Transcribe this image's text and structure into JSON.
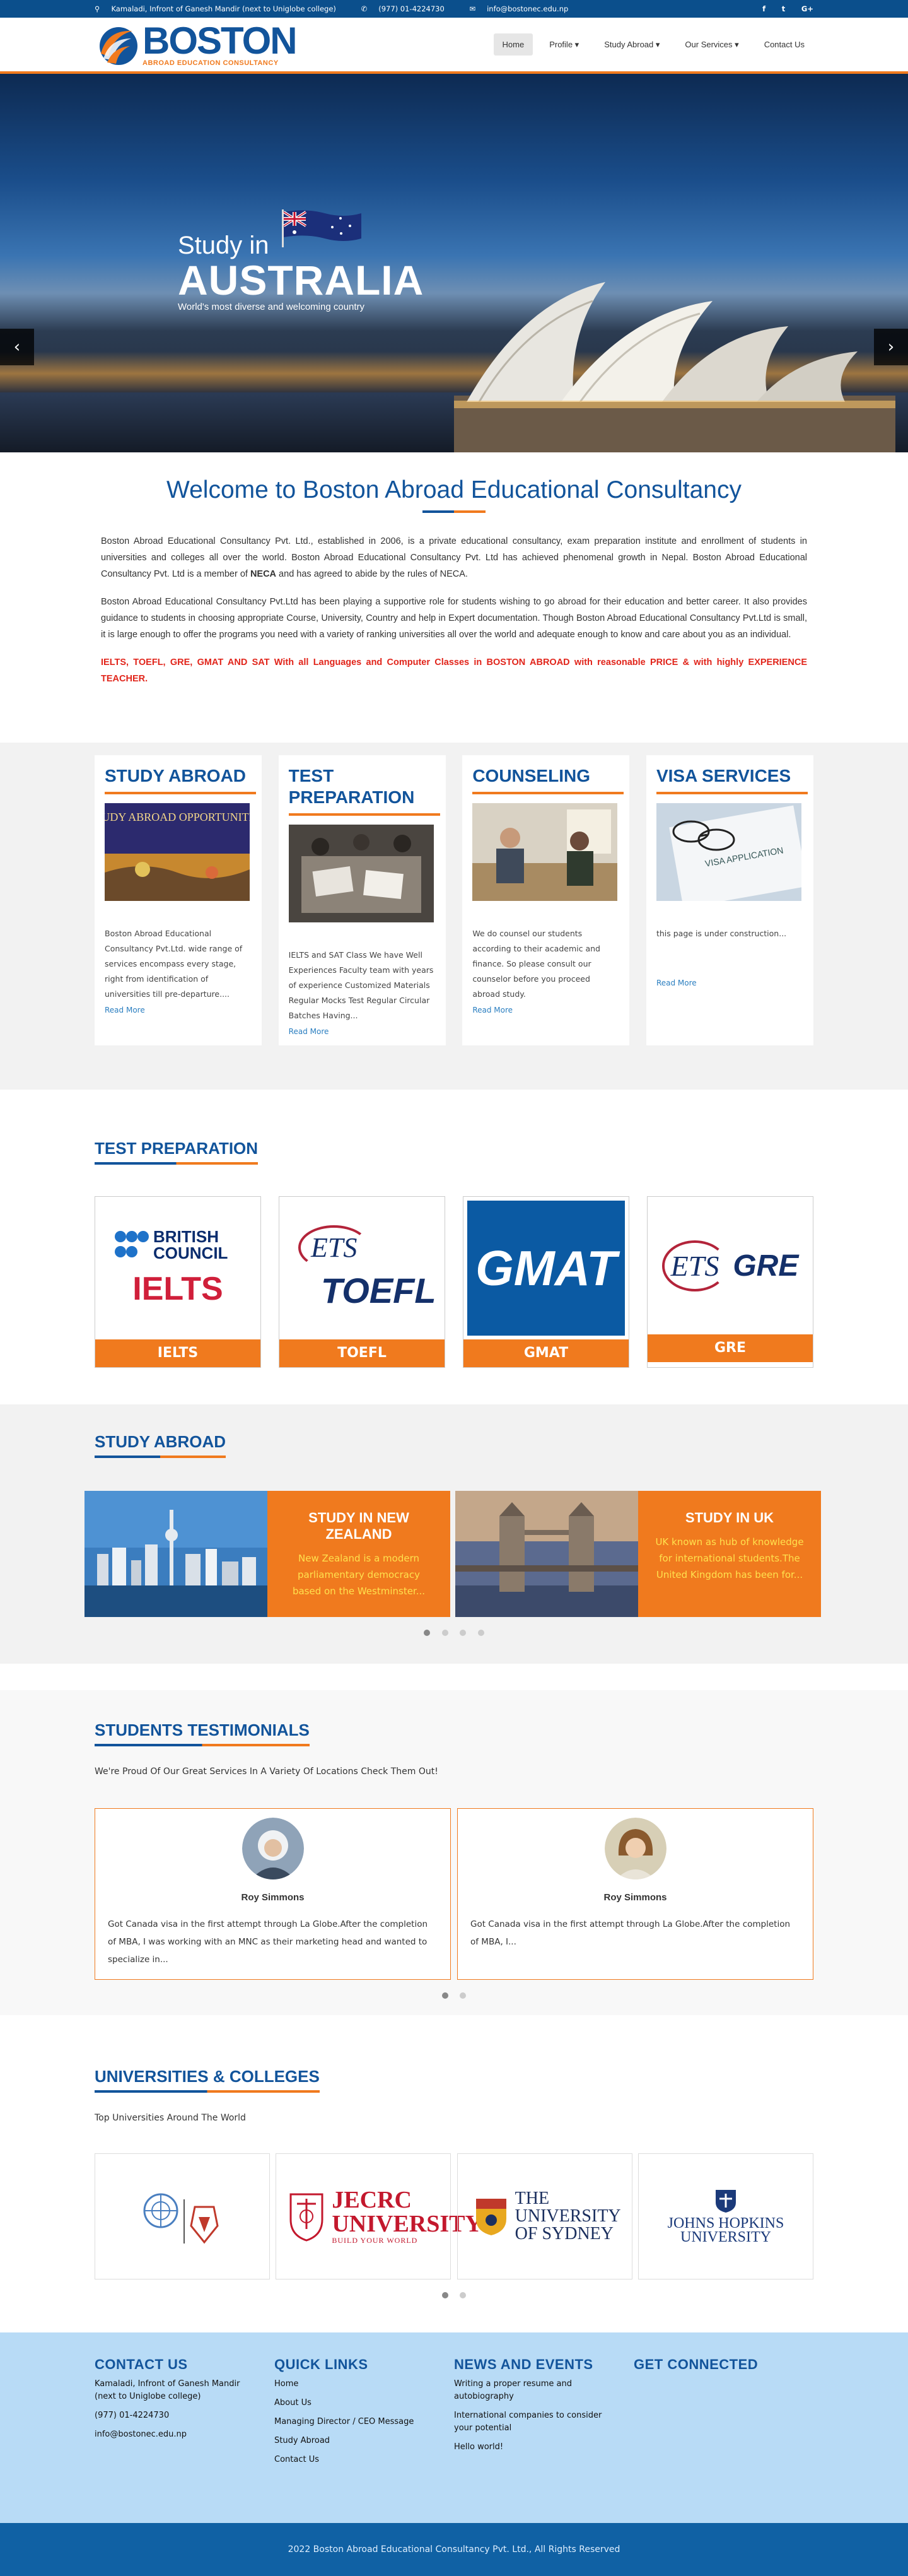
{
  "topbar": {
    "address": "Kamaladi, Infront of Ganesh Mandir (next to Uniglobe college)",
    "phone": "(977) 01-4224730",
    "email": "info@bostonec.edu.np",
    "social": [
      "f",
      "t",
      "G+"
    ]
  },
  "header": {
    "logo_name": "BOSTON",
    "logo_tagline": "ABROAD EDUCATION CONSULTANCY",
    "nav": [
      "Home",
      "Profile ▾",
      "Study Abroad ▾",
      "Our Services ▾",
      "Contact Us"
    ],
    "active_nav": "Home"
  },
  "hero": {
    "study": "Study in",
    "country": "AUSTRALIA",
    "subtitle": "World's most diverse and welcoming country",
    "prev": "‹",
    "next": "›"
  },
  "welcome": {
    "title": "Welcome to Boston Abroad Educational Consultancy",
    "p1_a": "Boston Abroad Educational Consultancy Pvt. Ltd., established in 2006, is a private educational consultancy, exam preparation institute and enrollment of students in universities and colleges all over the world. Boston Abroad Educational Consultancy Pvt. Ltd has achieved phenomenal growth in Nepal. Boston Abroad Educational Consultancy Pvt. Ltd is a member of ",
    "p1_bold": "NECA",
    "p1_b": "  and has agreed to abide by the rules of NECA.",
    "p2": "Boston Abroad Educational Consultancy Pvt.Ltd has been playing a supportive role for students wishing to go abroad for their education and better career. It also provides guidance to students in choosing appropriate Course, University, Country and help in Expert documentation. Though Boston Abroad Educational Consultancy Pvt.Ltd is small, it is large enough to offer the programs you need with a variety of ranking universities all over the world and adequate enough to know and care about you as an individual.",
    "p3": "IELTS, TOEFL, GRE, GMAT AND SAT With all Languages and Computer Classes in BOSTON ABROAD with reasonable PRICE & with highly EXPERIENCE TEACHER."
  },
  "services": [
    {
      "title": "STUDY ABROAD",
      "text": "Boston Abroad Educational Consultancy Pvt.Ltd. wide range of services encompass every stage, right from identification of universities till pre-departure....",
      "more": "Read More",
      "img_caption": "STUDY ABROAD OPPORTUNITIES"
    },
    {
      "title": "TEST PREPARATION",
      "text": "IELTS and SAT Class We have Well Experiences Faculty team with years of experience Customized Materials Regular Mocks Test Regular Circular Batches Having...",
      "more": "Read More",
      "img_caption": ""
    },
    {
      "title": "COUNSELING",
      "text": "We do counsel our students according to their academic and finance. So please consult our counselor before you proceed abroad study.",
      "more": "Read More",
      "img_caption": ""
    },
    {
      "title": "VISA SERVICES",
      "text": "this page is under construction...",
      "more": "Read More",
      "img_caption": "VISA APPLICATION"
    }
  ],
  "test_prep": {
    "title": "TEST PREPARATION",
    "items": [
      {
        "label": "IELTS",
        "logo_top": "BRITISH COUNCIL",
        "logo_bottom": "IELTS"
      },
      {
        "label": "TOEFL",
        "logo_top": "ETS",
        "logo_bottom": "TOEFL"
      },
      {
        "label": "GMAT",
        "logo_top": "",
        "logo_bottom": "GMAT"
      },
      {
        "label": "GRE",
        "logo_top": "ETS",
        "logo_bottom": "GRE"
      }
    ]
  },
  "study_abroad": {
    "title": "STUDY ABROAD",
    "items": [
      {
        "title": "STUDY IN NEW ZEALAND",
        "text": "New Zealand is a modern parliamentary democracy based on the Westminster..."
      },
      {
        "title": "STUDY IN UK",
        "text": "UK known as hub of knowledge for international students.The United Kingdom has been for..."
      }
    ]
  },
  "testimonials": {
    "title": "STUDENTS TESTIMONIALS",
    "lead": "We're Proud Of Our Great Services In A Variety Of Locations Check Them Out!",
    "items": [
      {
        "name": "Roy Simmons",
        "text": "Got Canada visa in the first attempt through La Globe.After the completion of MBA, I was working with an MNC as their marketing head and wanted to specialize in..."
      },
      {
        "name": "Roy Simmons",
        "text": "Got Canada visa in the first attempt through La Globe.After the completion of MBA, I..."
      }
    ]
  },
  "universities": {
    "title": "UNIVERSITIES & COLLEGES",
    "lead": "Top Universities Around The World",
    "items": [
      "",
      "JECRC UNIVERSITY",
      "THE UNIVERSITY OF SYDNEY",
      "JOHNS HOPKINS UNIVERSITY"
    ],
    "jecrc_tag": "BUILD YOUR WORLD"
  },
  "footer": {
    "contact_title": "CONTACT US",
    "contact_lines": [
      "Kamaladi, Infront of Ganesh Mandir (next to Uniglobe college)",
      "(977) 01-4224730",
      "info@bostonec.edu.np"
    ],
    "links_title": "QUICK LINKS",
    "links": [
      "Home",
      "About Us",
      "Managing Director / CEO Message",
      "Study Abroad",
      "Contact Us"
    ],
    "news_title": "NEWS AND EVENTS",
    "news": [
      "Writing a proper resume and autobiography",
      "International companies to consider your potential",
      "Hello world!"
    ],
    "connect_title": "GET CONNECTED",
    "copyright": "2022 Boston Abroad Educational Consultancy Pvt. Ltd., All Rights Reserved"
  },
  "colors": {
    "brand_blue": "#12549b",
    "accent_orange": "#f07a1e",
    "footer_bg": "#b8dbf6",
    "copyright_bg": "#1061a4"
  }
}
